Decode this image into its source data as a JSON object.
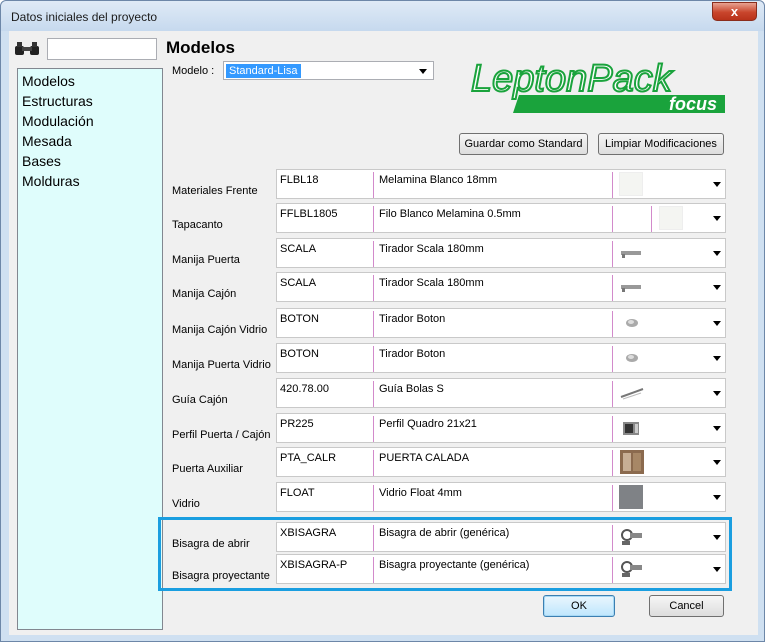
{
  "window": {
    "title": "Datos iniciales del proyecto",
    "close_label": "x"
  },
  "search": {
    "value": ""
  },
  "sidebar": {
    "items": [
      "Modelos",
      "Estructuras",
      "Modulación",
      "Mesada",
      "Bases",
      "Molduras"
    ]
  },
  "main": {
    "heading": "Modelos",
    "model_label": "Modelo :",
    "model_value": "Standard-Lisa",
    "logo_text": "LeptonPack",
    "logo_sub": "focus",
    "save_standard_label": "Guardar como Standard",
    "clear_label": "Limpiar Modificaciones",
    "rows": [
      {
        "label": "Materiales Frente",
        "code": "FLBL18",
        "desc": "Melamina Blanco 18mm",
        "icon": "white-swatch"
      },
      {
        "label": "Tapacanto",
        "code": "FFLBL1805",
        "desc": "Filo Blanco Melamina 0.5mm",
        "icon": "white-swatch"
      },
      {
        "label": "Manija Puerta",
        "code": "SCALA",
        "desc": "Tirador Scala 180mm",
        "icon": "handle-icon"
      },
      {
        "label": "Manija Cajón",
        "code": "SCALA",
        "desc": "Tirador Scala 180mm",
        "icon": "handle-icon"
      },
      {
        "label": "Manija Cajón Vidrio",
        "code": "BOTON",
        "desc": "Tirador Boton",
        "icon": "knob-icon"
      },
      {
        "label": "Manija Puerta Vidrio",
        "code": "BOTON",
        "desc": "Tirador Boton",
        "icon": "knob-icon"
      },
      {
        "label": "Guía Cajón",
        "code": "420.78.00",
        "desc": "Guía Bolas S",
        "icon": "slide-icon"
      },
      {
        "label": "Perfil Puerta / Cajón",
        "code": "PR225",
        "desc": "Perfil Quadro 21x21",
        "icon": "profile-icon"
      },
      {
        "label": "Puerta Auxiliar",
        "code": "PTA_CALR",
        "desc": "PUERTA CALADA",
        "icon": "door-icon"
      },
      {
        "label": "Vidrio",
        "code": "FLOAT",
        "desc": "Vidrio Float 4mm",
        "icon": "glass-swatch"
      },
      {
        "label": "Bisagra de abrir",
        "code": "XBISAGRA",
        "desc": "Bisagra de abrir (genérica)",
        "icon": "hinge-icon"
      },
      {
        "label": "Bisagra proyectante",
        "code": "XBISAGRA-P",
        "desc": "Bisagra proyectante (genérica)",
        "icon": "hinge-icon"
      }
    ],
    "ok_label": "OK",
    "cancel_label": "Cancel"
  },
  "colors": {
    "highlight": "#1a9ee0",
    "accent_green": "#1aa33c",
    "sidebar_bg": "#dffdfc"
  }
}
